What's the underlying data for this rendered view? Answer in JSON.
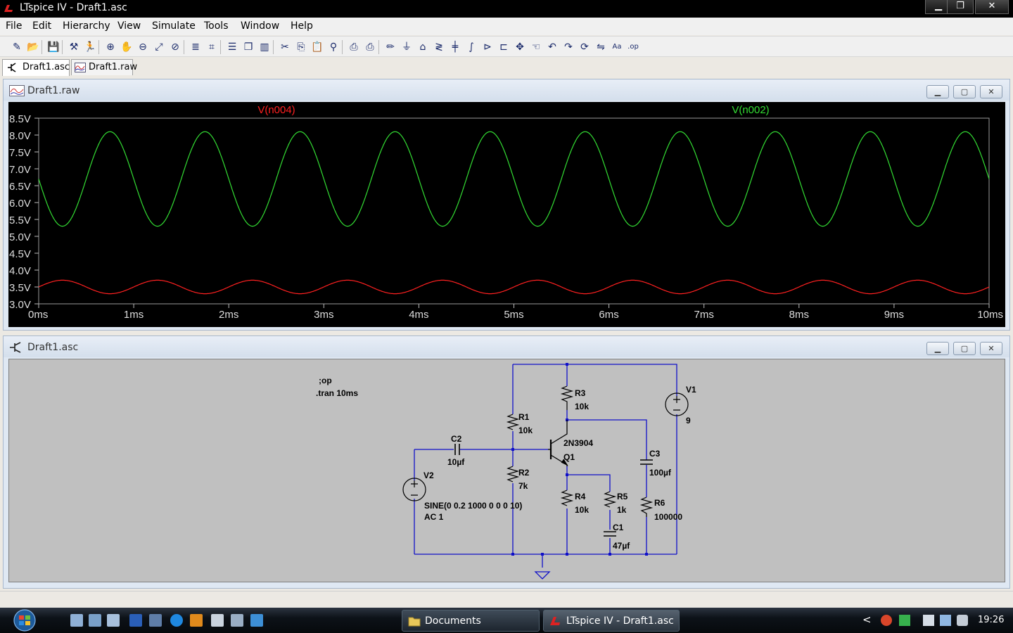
{
  "window": {
    "title": "LTspice IV - Draft1.asc"
  },
  "title_buttons": {
    "minimize": "▁",
    "maximize": "❐",
    "close": "✕"
  },
  "menu": [
    {
      "label": "File"
    },
    {
      "label": "Edit"
    },
    {
      "label": "Hierarchy"
    },
    {
      "label": "View"
    },
    {
      "label": "Simulate"
    },
    {
      "label": "Tools"
    },
    {
      "label": "Window"
    },
    {
      "label": "Help"
    }
  ],
  "toolbar": [
    "new-schematic-icon",
    "open-icon",
    "save-icon",
    "control-panel-icon",
    "run-icon",
    "zoom-in-icon",
    "pan-icon",
    "zoom-out-icon",
    "zoom-fit-icon",
    "zoom-cancel-icon",
    "autorange-icon",
    "grid-icon",
    "tile-horizontal-icon",
    "cascade-icon",
    "tile-vertical-icon",
    "cut-icon",
    "copy-icon",
    "paste-icon",
    "find-icon",
    "print-setup-icon",
    "print-icon",
    "wire-icon",
    "ground-icon",
    "label-net-icon",
    "resistor-icon",
    "capacitor-icon",
    "inductor-icon",
    "diode-icon",
    "component-icon",
    "move-icon",
    "drag-icon",
    "undo-icon",
    "redo-icon",
    "rotate-icon",
    "mirror-icon",
    "text-icon",
    "spice-directive-icon"
  ],
  "tabs": [
    {
      "label": "Draft1.asc",
      "icon": "schematic-icon"
    },
    {
      "label": "Draft1.raw",
      "icon": "waveform-icon"
    }
  ],
  "plot_window": {
    "title": "Draft1.raw"
  },
  "schematic_window": {
    "title": "Draft1.asc"
  },
  "child_buttons": {
    "minimize": "▁",
    "restore": "▢",
    "close": "✕"
  },
  "chart_data": {
    "type": "line",
    "xlabel": "",
    "ylabel": "",
    "xlim": [
      0,
      10
    ],
    "ylim": [
      3.0,
      8.5
    ],
    "xticks": [
      "0ms",
      "1ms",
      "2ms",
      "3ms",
      "4ms",
      "5ms",
      "6ms",
      "7ms",
      "8ms",
      "9ms",
      "10ms"
    ],
    "yticks": [
      "3.0V",
      "3.5V",
      "4.0V",
      "4.5V",
      "5.0V",
      "5.5V",
      "6.0V",
      "6.5V",
      "7.0V",
      "7.5V",
      "8.0V",
      "8.5V"
    ],
    "grid": false,
    "series": [
      {
        "name": "V(n004)",
        "color": "#ff2020",
        "offset": 3.5,
        "amplitude": 0.2,
        "frequency_khz": 1,
        "phase_deg": 0
      },
      {
        "name": "V(n002)",
        "color": "#33dd33",
        "offset": 6.7,
        "amplitude": 1.4,
        "frequency_khz": 1,
        "phase_deg": 180
      }
    ]
  },
  "schematic": {
    "directives": [
      ";op",
      ".tran 10ms"
    ],
    "components": {
      "R1": {
        "name": "R1",
        "value": "10k"
      },
      "R2": {
        "name": "R2",
        "value": "7k"
      },
      "R3": {
        "name": "R3",
        "value": "10k"
      },
      "R4": {
        "name": "R4",
        "value": "10k"
      },
      "R5": {
        "name": "R5",
        "value": "1k"
      },
      "R6": {
        "name": "R6",
        "value": "100000"
      },
      "C1": {
        "name": "C1",
        "value": "47µf"
      },
      "C2": {
        "name": "C2",
        "value": "10µf"
      },
      "C3": {
        "name": "C3",
        "value": "100µf"
      },
      "Q1": {
        "name": "Q1",
        "value": "2N3904"
      },
      "V1": {
        "name": "V1",
        "value": "9"
      },
      "V2": {
        "name": "V2",
        "value": "SINE(0 0.2 1000 0 0 0 10)",
        "value2": "AC 1"
      }
    }
  },
  "taskbar": {
    "buttons": [
      {
        "label": "Documents",
        "icon": "folder-icon"
      },
      {
        "label": "LTspice IV - Draft1.asc",
        "icon": "ltspice-icon"
      }
    ],
    "clock": "19:26",
    "tray_chevron": "<"
  }
}
